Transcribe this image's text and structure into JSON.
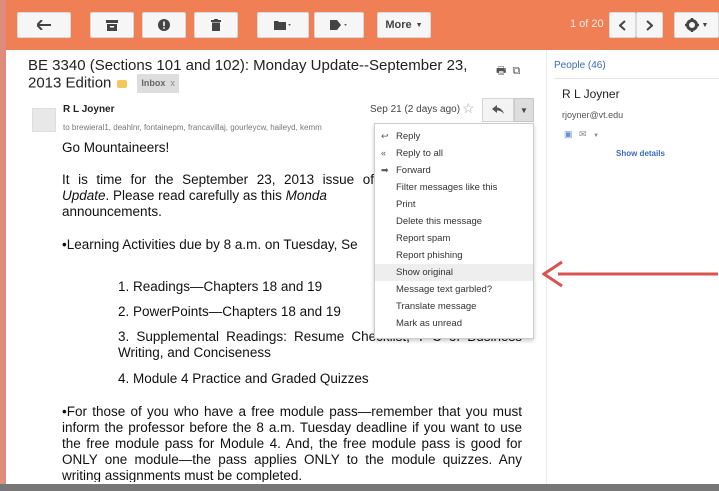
{
  "toolbar": {
    "icons": [
      "back-icon",
      "archive-icon",
      "report-spam-icon",
      "delete-icon",
      "folder-icon",
      "label-icon",
      "settings-icon"
    ],
    "more_label": "More",
    "pager": "1 of 20",
    "accent": "#f07f55"
  },
  "subject": {
    "text": "BE 3340 (Sections 101 and 102): Monday Update--September 23, 2013 Edition",
    "label": "Inbox",
    "label_close": "x"
  },
  "message": {
    "sender": "R L Joyner",
    "recipients": "to brewieral1, deahlnr, fontainepm, francavillaj, gourleycw, haileyd, kemm",
    "date": "Sep 21 (2 days ago)",
    "body": {
      "greeting": "Go Mountaineers!",
      "p1_a": "It is time for the September 23, 2013 issue of",
      "p1_b": "Update",
      "p1_c": ". Please read carefully as this",
      "p1_d": "Monda",
      "p1_e": "announcements.",
      "p2": "•Learning Activities due by 8 a.m. on Tuesday, Se",
      "items": [
        "1.  Readings—Chapters 18 and 19",
        "2.  PowerPoints—Chapters 18 and 19",
        "3.  Supplemental Readings: Resume Checklist, T  C  of Business Writing, and Conciseness",
        "4.  Module 4 Practice and Graded Quizzes"
      ],
      "p3": "•For those of you who have a free module pass—remember that you must inform the professor before the 8 a.m. Tuesday deadline if you want to use the free module pass for Module 4.  And, the free module pass is good for ONLY one module—the pass applies ONLY to the module quizzes.  Any writing assignments must be completed."
    }
  },
  "menu": {
    "items": [
      {
        "label": "Reply",
        "icon": "reply-icon",
        "glyph": "↩"
      },
      {
        "label": "Reply to all",
        "icon": "reply-all-icon",
        "glyph": "«"
      },
      {
        "label": "Forward",
        "icon": "forward-icon",
        "glyph": "➡"
      },
      {
        "label": "Filter messages like this",
        "icon": "",
        "glyph": ""
      },
      {
        "label": "Print",
        "icon": "",
        "glyph": ""
      },
      {
        "label": "Delete this message",
        "icon": "",
        "glyph": ""
      },
      {
        "label": "Report spam",
        "icon": "",
        "glyph": ""
      },
      {
        "label": "Report phishing",
        "icon": "",
        "glyph": ""
      },
      {
        "label": "Show original",
        "icon": "",
        "glyph": "",
        "highlighted": true
      },
      {
        "label": "Message text garbled?",
        "icon": "",
        "glyph": ""
      },
      {
        "label": "Translate message",
        "icon": "",
        "glyph": ""
      },
      {
        "label": "Mark as unread",
        "icon": "",
        "glyph": ""
      }
    ]
  },
  "sidebar": {
    "people_label": "People (46)",
    "name": "R L Joyner",
    "email": "rjoyner@vt.edu",
    "details_link": "Show details"
  },
  "annotation": {
    "arrow_color": "#d9534f"
  }
}
